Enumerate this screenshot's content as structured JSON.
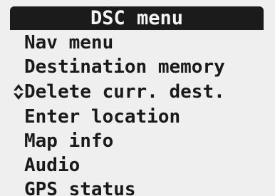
{
  "menu": {
    "title": "DSC menu",
    "items": [
      {
        "label": "Nav menu"
      },
      {
        "label": "Destination memory"
      },
      {
        "label": "Delete curr. dest."
      },
      {
        "label": "Enter location"
      },
      {
        "label": "Map info"
      },
      {
        "label": "Audio"
      },
      {
        "label": "GPS status"
      }
    ],
    "selected_index": 2,
    "scroll_icon": "up-down-scroll-icon"
  }
}
